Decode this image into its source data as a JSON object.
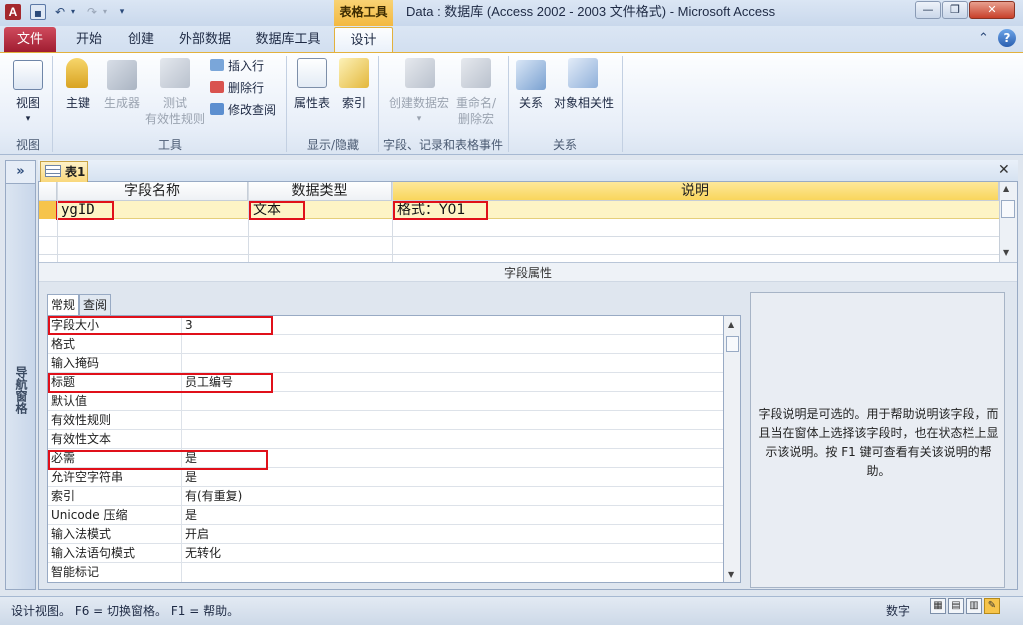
{
  "titlebar": {
    "app_icon": "A",
    "context_tab": "表格工具",
    "title": "Data : 数据库 (Access 2002 - 2003 文件格式) - Microsoft Access",
    "qat": [
      "save-icon",
      "undo-icon",
      "redo-icon",
      "customize-icon"
    ],
    "window_buttons": [
      "—",
      "❐",
      "✕"
    ]
  },
  "tabs": {
    "file": "文件",
    "items": [
      "开始",
      "创建",
      "外部数据",
      "数据库工具",
      "设计"
    ],
    "active": "设计"
  },
  "ribbon": {
    "view": {
      "label": "视图",
      "group": "视图"
    },
    "tools": {
      "group": "工具",
      "primary_key": "主键",
      "builder": "生成器",
      "test_rules": "测试\n有效性规则",
      "insert_row": "插入行",
      "delete_row": "删除行",
      "modify_lookup": "修改查阅"
    },
    "show_hide": {
      "group": "显示/隐藏",
      "property_sheet": "属性表",
      "indexes": "索引"
    },
    "events": {
      "group": "字段、记录和表格事件",
      "create_macro": "创建数据宏",
      "rename_delete_macro_1": "重命名/",
      "rename_delete_macro_2": "删除宏"
    },
    "relationships": {
      "group": "关系",
      "relationships": "关系",
      "dependencies": "对象相关性"
    }
  },
  "nav": {
    "chevron": "»",
    "label": "导航窗格"
  },
  "document": {
    "tab_label": "表1",
    "close": "✕",
    "grid": {
      "headers": [
        "字段名称",
        "数据类型",
        "说明"
      ],
      "rows": [
        {
          "name": "ygID",
          "type": "文本",
          "desc": "格式：Y01"
        }
      ]
    },
    "field_props_title": "字段属性",
    "prop_tabs": [
      "常规",
      "查阅"
    ],
    "props": [
      {
        "label": "字段大小",
        "value": "3"
      },
      {
        "label": "格式",
        "value": ""
      },
      {
        "label": "输入掩码",
        "value": ""
      },
      {
        "label": "标题",
        "value": "员工编号"
      },
      {
        "label": "默认值",
        "value": ""
      },
      {
        "label": "有效性规则",
        "value": ""
      },
      {
        "label": "有效性文本",
        "value": ""
      },
      {
        "label": "必需",
        "value": "是"
      },
      {
        "label": "允许空字符串",
        "value": "是"
      },
      {
        "label": "索引",
        "value": "有(有重复)"
      },
      {
        "label": "Unicode 压缩",
        "value": "是"
      },
      {
        "label": "输入法模式",
        "value": "开启"
      },
      {
        "label": "输入法语句模式",
        "value": "无转化"
      },
      {
        "label": "智能标记",
        "value": ""
      }
    ],
    "help_text": "字段说明是可选的。用于帮助说明该字段，而且当在窗体上选择该字段时，也在状态栏上显示该说明。按 F1 键可查看有关该说明的帮助。"
  },
  "status": {
    "text": "设计视图。  F6 = 切换窗格。  F1 = 帮助。",
    "num": "数字"
  },
  "colors": {
    "accent": "#f3b941",
    "file_tab": "#b72a3e",
    "highlight": "#e0101a"
  }
}
